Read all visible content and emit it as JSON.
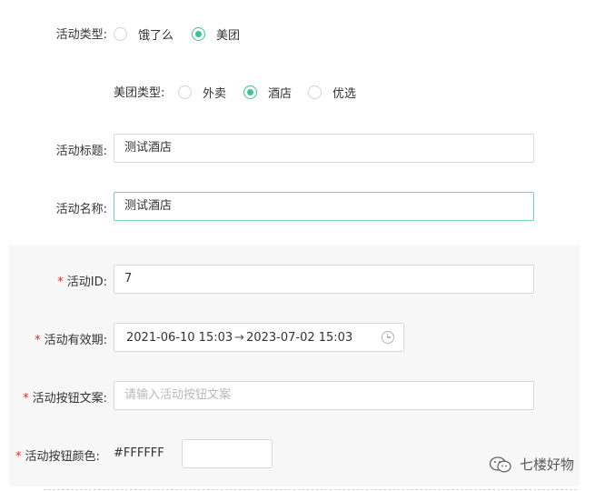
{
  "activity_type": {
    "label": "活动类型:",
    "options": [
      {
        "label": "饿了么",
        "selected": false
      },
      {
        "label": "美团",
        "selected": true
      }
    ]
  },
  "meituan_type": {
    "label": "美团类型:",
    "options": [
      {
        "label": "外卖",
        "selected": false
      },
      {
        "label": "酒店",
        "selected": true
      },
      {
        "label": "优选",
        "selected": false
      }
    ]
  },
  "activity_title": {
    "label": "活动标题:",
    "value": "测试酒店"
  },
  "activity_name": {
    "label": "活动名称:",
    "value": "测试酒店"
  },
  "activity_id": {
    "required": "*",
    "label": "活动ID:",
    "value": "7"
  },
  "validity": {
    "required": "*",
    "label": "活动有效期:",
    "start": "2021-06-10 15:03",
    "arrow": "→",
    "end": "2023-07-02 15:03",
    "icon": "clock-icon"
  },
  "button_text": {
    "required": "*",
    "label": "活动按钮文案:",
    "placeholder": "请输入活动按钮文案",
    "value": ""
  },
  "button_color": {
    "required": "*",
    "label": "活动按钮颜色:",
    "value": "#FFFFFF"
  },
  "watermark": {
    "icon": "wechat-icon",
    "text": "七楼好物"
  },
  "colors": {
    "accent": "#3ec28f",
    "required": "#f5222d",
    "panel": "#f7f7f7"
  }
}
